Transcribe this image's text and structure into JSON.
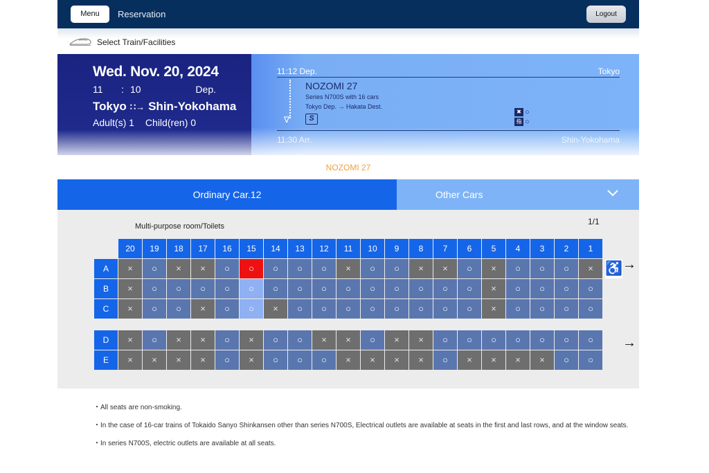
{
  "header": {
    "menu_label": "Menu",
    "title": "Reservation",
    "logout_label": "Logout"
  },
  "breadcrumb": {
    "label": "Select Train/Facilities",
    "icon": "shinkansen-icon"
  },
  "summary": {
    "date": "Wed. Nov. 20, 2024",
    "time_hour": "11",
    "time_colon": ":",
    "time_minute": "10",
    "dep_label": "Dep.",
    "from": "Tokyo",
    "route_arrow": "∷→",
    "to": "Shin-Yokohama",
    "adults": "Adult(s) 1",
    "children": "Child(ren) 0"
  },
  "train_info": {
    "dep_time": "11:12 Dep.",
    "dep_station": "Tokyo",
    "name": "NOZOMI 27",
    "series": "Series N700S with 16 cars",
    "route": "Tokyo Dep. → Hakata Dest.",
    "s_mark": "S",
    "facility_1_value": "○",
    "facility_2_value": "○",
    "arr_time": "11:30 Arr.",
    "arr_station": "Shin-Yokohama"
  },
  "train_heading": "NOZOMI 27",
  "tabs": {
    "active": "Ordinary Car.12",
    "other": "Other Cars"
  },
  "seat_map": {
    "facility_label": "Multi-purpose room/Toilets",
    "page": "1/1",
    "columns": [
      "20",
      "19",
      "18",
      "17",
      "16",
      "15",
      "14",
      "13",
      "12",
      "11",
      "10",
      "9",
      "8",
      "7",
      "6",
      "5",
      "4",
      "3",
      "2",
      "1"
    ],
    "available_mark": "○",
    "occupied_mark": "×",
    "upper_rows": [
      {
        "label": "A",
        "seats": [
          "x",
          "o",
          "x",
          "x",
          "o",
          "sel",
          "o",
          "o",
          "o",
          "x",
          "o",
          "o",
          "x",
          "x",
          "o",
          "x",
          "o",
          "o",
          "o",
          "x"
        ]
      },
      {
        "label": "B",
        "seats": [
          "x",
          "o",
          "o",
          "o",
          "o",
          "hl",
          "o",
          "o",
          "o",
          "o",
          "o",
          "o",
          "o",
          "o",
          "o",
          "x",
          "o",
          "o",
          "o",
          "o"
        ]
      },
      {
        "label": "C",
        "seats": [
          "x",
          "o",
          "o",
          "x",
          "o",
          "hl",
          "x",
          "o",
          "o",
          "o",
          "o",
          "o",
          "o",
          "o",
          "o",
          "x",
          "o",
          "o",
          "o",
          "o"
        ]
      }
    ],
    "lower_rows": [
      {
        "label": "D",
        "seats": [
          "x",
          "o",
          "x",
          "x",
          "o",
          "x",
          "o",
          "o",
          "x",
          "x",
          "o",
          "x",
          "x",
          "o",
          "o",
          "o",
          "o",
          "o",
          "o",
          "o"
        ]
      },
      {
        "label": "E",
        "seats": [
          "x",
          "x",
          "x",
          "x",
          "o",
          "x",
          "o",
          "o",
          "o",
          "x",
          "x",
          "x",
          "x",
          "o",
          "x",
          "x",
          "x",
          "x",
          "o",
          "o"
        ]
      }
    ],
    "wheelchair_icon": "wheelchair-icon",
    "arrow_symbol": "→"
  },
  "notes": [
    "・All seats are non-smoking.",
    "・In the case of 16-car trains of Tokaido Sanyo Shinkansen other than series N700S, Electrical outlets are available at seats in the first and last rows, and at the window seats.",
    "・In series N700S, electric outlets are available at all seats."
  ],
  "colors": {
    "header_bg": "#062f5e",
    "summary_left_bg": "#1f2a8c",
    "summary_right_bg": "#7db3f8",
    "tab_active": "#1565e8",
    "tab_other": "#7eb4f7",
    "seat_available": "#5a76ae",
    "seat_occupied": "#6e6e6e",
    "seat_selected": "#ee1111",
    "train_heading": "#f0a040"
  }
}
